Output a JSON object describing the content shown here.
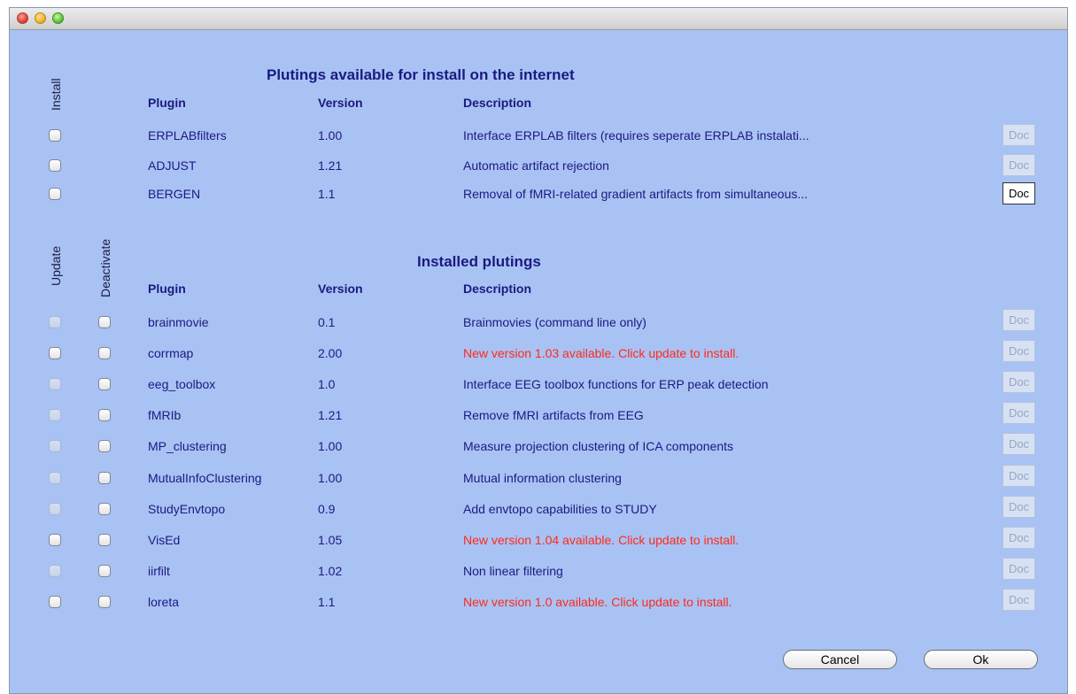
{
  "available": {
    "title": "Plutings available for install on the internet",
    "install_label": "Install",
    "headers": {
      "plugin": "Plugin",
      "version": "Version",
      "description": "Description"
    },
    "rows": [
      {
        "plugin": "ERPLABfilters",
        "version": "1.00",
        "description": "Interface ERPLAB filters (requires seperate ERPLAB instalati...",
        "doc": "Doc",
        "doc_enabled": false
      },
      {
        "plugin": "ADJUST",
        "version": "1.21",
        "description": "Automatic artifact rejection",
        "doc": "Doc",
        "doc_enabled": false
      },
      {
        "plugin": "BERGEN",
        "version": "1.1",
        "description": "Removal of fMRI-related gradient artifacts from simultaneous...",
        "doc": "Doc",
        "doc_enabled": true
      }
    ]
  },
  "installed": {
    "title": "Installed plutings",
    "update_label": "Update",
    "deactivate_label": "Deactivate",
    "headers": {
      "plugin": "Plugin",
      "version": "Version",
      "description": "Description"
    },
    "rows": [
      {
        "plugin": "brainmovie",
        "version": "0.1",
        "description": "Brainmovies (command line only)",
        "update_enabled": false,
        "doc": "Doc"
      },
      {
        "plugin": "corrmap",
        "version": "2.00",
        "description": "New version 1.03 available. Click update to install.",
        "update_enabled": true,
        "doc": "Doc"
      },
      {
        "plugin": "eeg_toolbox",
        "version": "1.0",
        "description": "Interface EEG toolbox functions for ERP peak detection",
        "update_enabled": false,
        "doc": "Doc"
      },
      {
        "plugin": "fMRIb",
        "version": "1.21",
        "description": "Remove fMRI artifacts from EEG",
        "update_enabled": false,
        "doc": "Doc"
      },
      {
        "plugin": "MP_clustering",
        "version": "1.00",
        "description": "Measure projection clustering of ICA components",
        "update_enabled": false,
        "doc": "Doc"
      },
      {
        "plugin": "MutualInfoClustering",
        "version": "1.00",
        "description": "Mutual information clustering",
        "update_enabled": false,
        "doc": "Doc"
      },
      {
        "plugin": "StudyEnvtopo",
        "version": "0.9",
        "description": "Add envtopo capabilities to STUDY",
        "update_enabled": false,
        "doc": "Doc"
      },
      {
        "plugin": "VisEd",
        "version": "1.05",
        "description": "New version 1.04 available. Click update to install.",
        "update_enabled": true,
        "doc": "Doc"
      },
      {
        "plugin": "iirfilt",
        "version": "1.02",
        "description": "Non linear filtering",
        "update_enabled": false,
        "doc": "Doc"
      },
      {
        "plugin": "loreta",
        "version": "1.1",
        "description": "New version 1.0 available. Click update to install.",
        "update_enabled": true,
        "doc": "Doc"
      }
    ]
  },
  "buttons": {
    "cancel": "Cancel",
    "ok": "Ok"
  },
  "colors": {
    "background": "#a9c2f4",
    "text": "#1a1a80",
    "update_notice": "#ff2a1a"
  }
}
